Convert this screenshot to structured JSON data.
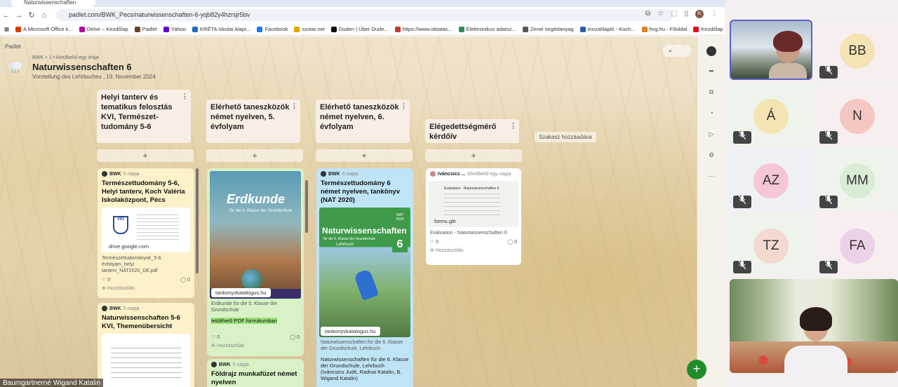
{
  "browser": {
    "tab_title": "Naturwissenschaften",
    "url": "padlet.com/BWK_Pecs/naturwissenschaften-6-yqb82y4hzrsjr5bv",
    "profile_initial": "K",
    "bookmarks": [
      {
        "label": "A Microsoft Office k...",
        "color": "#d83b01"
      },
      {
        "label": "Delve – Kezdőlap",
        "color": "#b4009e"
      },
      {
        "label": "Padlet",
        "color": "#6b4226"
      },
      {
        "label": "Yahoo",
        "color": "#5f01d1"
      },
      {
        "label": "KRÉTA Iskolai Alapr...",
        "color": "#1b6ec2"
      },
      {
        "label": "Facebook",
        "color": "#1877f2"
      },
      {
        "label": "szotar.net",
        "color": "#e0a800"
      },
      {
        "label": "Duden | Über Dude...",
        "color": "#111111"
      },
      {
        "label": "https://www.oktatas...",
        "color": "#c0392b"
      },
      {
        "label": "Elektronikus adatsz...",
        "color": "#2e8b57"
      },
      {
        "label": "Zenei segédanyag",
        "color": "#555555"
      },
      {
        "label": "mozaNapló - Koch...",
        "color": "#2a5db0"
      },
      {
        "label": "hvg.hu - Főoldal",
        "color": "#e67e22"
      },
      {
        "label": "Kezdőlap - Netflix",
        "color": "#e50914"
      }
    ]
  },
  "padlet": {
    "brand": ":Padlet",
    "meta": "BWK + 1 • körülbelül egy órája",
    "title": "Naturwissenschaften 6",
    "subtitle": "Vorstellung des Lehrbuches , 19. November 2024",
    "add_section": "Szakasz hozzáadása",
    "add_symbol": "+",
    "menu_symbol": "⋮",
    "fab": "+",
    "columns": [
      {
        "title": "Helyi tanterv és tematikus felosztás KVI, Természet-tudomány 5-6"
      },
      {
        "title": "Elérhető taneszközök német nyelven, 5. évfolyam"
      },
      {
        "title": "Elérhető taneszközök német nyelven, 6. évfolyam"
      },
      {
        "title": "Elégedettségmérő kérdőív"
      }
    ],
    "cards": {
      "c1": {
        "author": "BWK",
        "time": "5 napja",
        "title": "Természettudomány 5-6, Helyi tanterv, Koch Valéria Iskolaközpont, Pécs",
        "link": "drive.google.com",
        "desc": "Természettudományok_5-6. évfolyam_helyi tanterv_NAT2020_DE.pdf",
        "likes": "0",
        "comments": "0",
        "comment_label": "Hozzászólás"
      },
      "c2": {
        "author": "BWK",
        "time": "5 napja",
        "title": "Naturwissenschaften 5-6 KVI, Themenübersicht"
      },
      "c3": {
        "book_title": "Erdkunde",
        "book_sub": "für die 5. Klasse der Grundschule",
        "link": "tankonyvkatalogus.hu",
        "desc": "Erdkunde für die 5. Klasse der Grundschule",
        "highlight": "letölthető PDF formátumban",
        "likes": "0",
        "comments": "0",
        "comment_label": "Hozzászólás"
      },
      "c4": {
        "author": "BWK",
        "time": "5 napja",
        "title": "Földrajz munkafüzet német nyelven"
      },
      "c5": {
        "author": "BWK",
        "time": "6 napja",
        "title": "Természettudomány 6 német nyelven, tankönyv (NAT 2020)",
        "book_title": "Naturwissenschaften",
        "book_sub": "für die 6. Klasse der Grundschule",
        "book_kind": "Lehrbuch",
        "book_badge": "6",
        "book_nat": "NAT 2020",
        "link": "tankonyvkatalogus.hu",
        "desc": "Naturwissenschaften für die 6. Klasse der Grundschule, Lehrbuch",
        "desc2": "Naturwissenschaften für die 6. Klasse der Grundschule, Lehrbuch (Iváncsics Judit, Radnai Katalin, B. Wigand Katalin)"
      },
      "c6": {
        "author": "Iváncsics ...",
        "time": "körülbelül egy napja",
        "preview": "Evaluation - Naturwissenschaften 6",
        "link": "forms.gle",
        "desc": "Evaluation - Naturwissenschaften 6",
        "likes": "0",
        "comments": "0",
        "comment_label": "Hozzászólás"
      }
    },
    "presenter": "Baumgartnerné Wigand Katalin"
  },
  "meeting": {
    "participants": [
      {
        "initials": "BB",
        "bg": "#f7eef0",
        "circle": "#f6e3b4"
      },
      {
        "initials": "Á",
        "bg": "#eef4ec",
        "circle": "#f6e3b4"
      },
      {
        "initials": "N",
        "bg": "#f7eef0",
        "circle": "#f4c7c3"
      },
      {
        "initials": "AZ",
        "bg": "#eef0f5",
        "circle": "#f5c6d6"
      },
      {
        "initials": "MM",
        "bg": "#eef4ec",
        "circle": "#d9ecd6"
      },
      {
        "initials": "TZ",
        "bg": "#eef4ec",
        "circle": "#f3d9cf"
      },
      {
        "initials": "FA",
        "bg": "#f7eef0",
        "circle": "#ecd2e8"
      }
    ],
    "mute_icon": "🎤"
  }
}
